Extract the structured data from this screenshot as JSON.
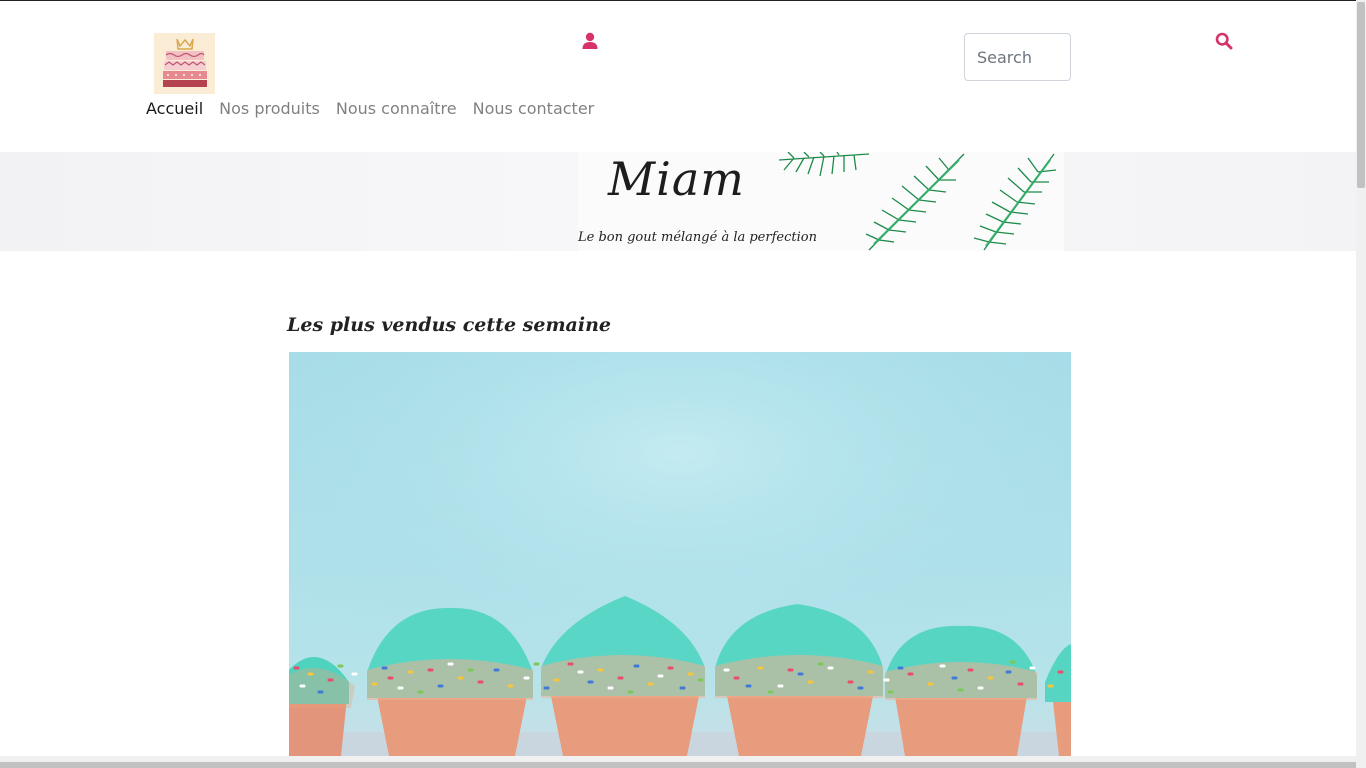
{
  "header": {
    "logo_icon": "cake-logo-icon",
    "account_icon": "user-icon",
    "search": {
      "placeholder": "Search",
      "value": ""
    },
    "search_icon": "search-icon",
    "accent_color": "#d6336c"
  },
  "nav": {
    "items": [
      {
        "label": "Accueil",
        "active": true
      },
      {
        "label": "Nos produits",
        "active": false
      },
      {
        "label": "Nous connaître",
        "active": false
      },
      {
        "label": "Nous contacter",
        "active": false
      }
    ]
  },
  "banner": {
    "title": "Miam",
    "tagline": "Le bon gout mélangé à la perfection"
  },
  "main": {
    "section_title": "Les plus vendus cette semaine"
  }
}
